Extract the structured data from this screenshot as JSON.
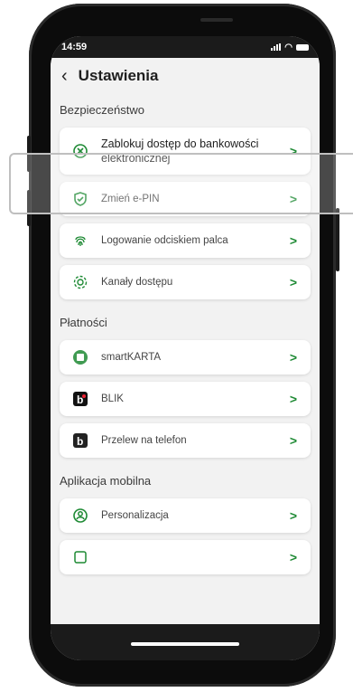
{
  "status": {
    "time": "14:59"
  },
  "header": {
    "title": "Ustawienia"
  },
  "sections": [
    {
      "label": "Bezpieczeństwo",
      "items": [
        {
          "label": "Zablokuj dostęp do bankowości elektronicznej",
          "icon": "block-icon"
        },
        {
          "label": "Zmień e-PIN",
          "icon": "shield-check-icon"
        },
        {
          "label": "Logowanie odciskiem palca",
          "icon": "fingerprint-icon"
        },
        {
          "label": "Kanały dostępu",
          "icon": "gear-icon"
        }
      ]
    },
    {
      "label": "Płatności",
      "items": [
        {
          "label": "smartKARTA",
          "icon": "smartkarta-icon"
        },
        {
          "label": "BLIK",
          "icon": "blik-icon"
        },
        {
          "label": "Przelew na telefon",
          "icon": "blik-phone-icon"
        }
      ]
    },
    {
      "label": "Aplikacja mobilna",
      "items": [
        {
          "label": "Personalizacja",
          "icon": "person-icon"
        },
        {
          "label": "",
          "icon": "partial-icon"
        }
      ]
    }
  ],
  "colors": {
    "accent": "#1e8a34",
    "phone": "#0c0c0c",
    "screen_bg": "#f2f2f2"
  }
}
